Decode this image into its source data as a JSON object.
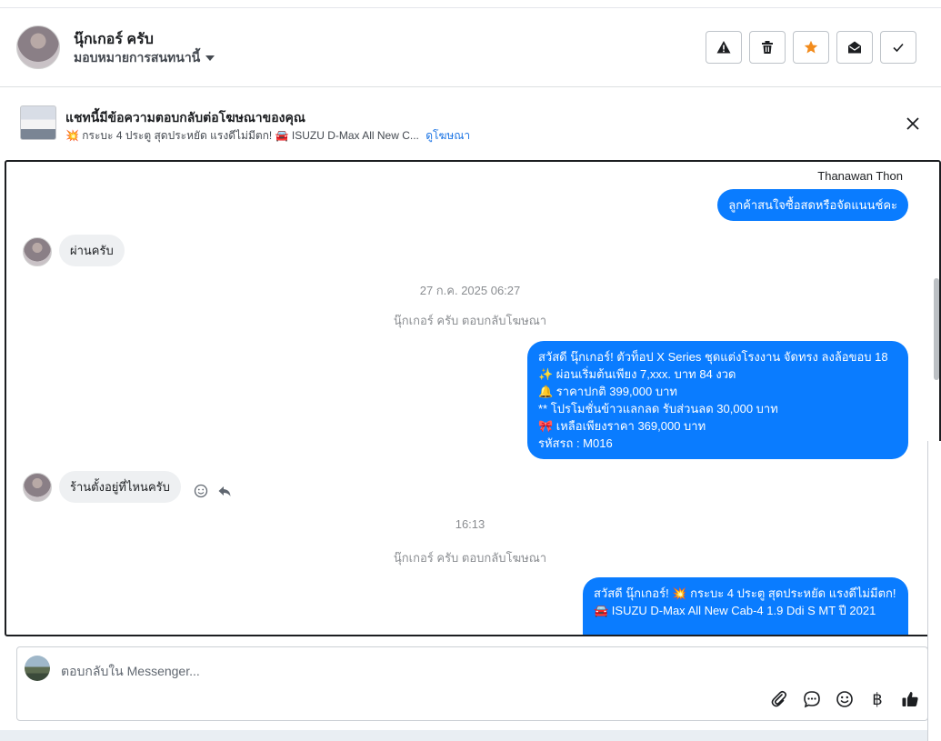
{
  "header": {
    "contact_name": "นุ๊กเกอร์ ครับ",
    "assign_label": "มอบหมายการสนทนานี้",
    "buttons": [
      "report-icon",
      "trash-icon",
      "star-icon",
      "mail-open-icon",
      "check-icon"
    ]
  },
  "ad_banner": {
    "title": "แชทนี้มีข้อความตอบกลับต่อโฆษณาของคุณ",
    "ad_text": "💥 กระบะ 4 ประตู สุดประหยัด แรงดีไม่มีตก! 🚘 ISUZU D-Max All New C...",
    "link": "ดูโฆษณา"
  },
  "chat": {
    "sender_name": "Thanawan Thon",
    "messages": [
      {
        "dir": "out",
        "text": "ลูกค้าสนใจซื้อสดหรือจัดแนนช์คะ"
      },
      {
        "dir": "in",
        "text": "ผ่านครับ"
      },
      {
        "dir": "note",
        "text": "27 ก.ค. 2025 06:27"
      },
      {
        "dir": "note",
        "text": "นุ๊กเกอร์ ครับ ตอบกลับโฆษณา"
      },
      {
        "dir": "out",
        "lines": [
          "สวัสดี นุ๊กเกอร์! ตัวท็อป X Series ชุดแต่งโรงงาน จัดทรง ลงล้อขอบ 18",
          "✨  ผ่อนเริ่มต้นเพียง 7,xxx. บาท 84 งวด",
          "🔔 ราคาปกติ 399,000 บาท",
          "** โปรโมชั่นข้าวแลกลด รับส่วนลด 30,000 บาท",
          "🎀  เหลือเพียงราคา 369,000 บาท",
          " รหัสรถ : M016"
        ]
      },
      {
        "dir": "in",
        "text": "ร้านตั้งอยู่ที่ไหนครับ"
      },
      {
        "dir": "note",
        "text": "16:13"
      },
      {
        "dir": "note",
        "text": "นุ๊กเกอร์ ครับ ตอบกลับโฆษณา"
      },
      {
        "dir": "out",
        "lines": [
          "สวัสดี นุ๊กเกอร์! 💥 กระบะ 4 ประตู สุดประหยัด แรงดีไม่มีตก!",
          "🚘 ISUZU D-Max All New Cab-4 1.9 Ddi S MT ปี 2021"
        ]
      }
    ]
  },
  "composer": {
    "placeholder": "ตอบกลับใน Messenger...",
    "tools": [
      "paperclip-icon",
      "message-icon",
      "emoji-icon",
      "baht-icon",
      "thumbs-up-icon"
    ],
    "baht_glyph": "฿"
  }
}
